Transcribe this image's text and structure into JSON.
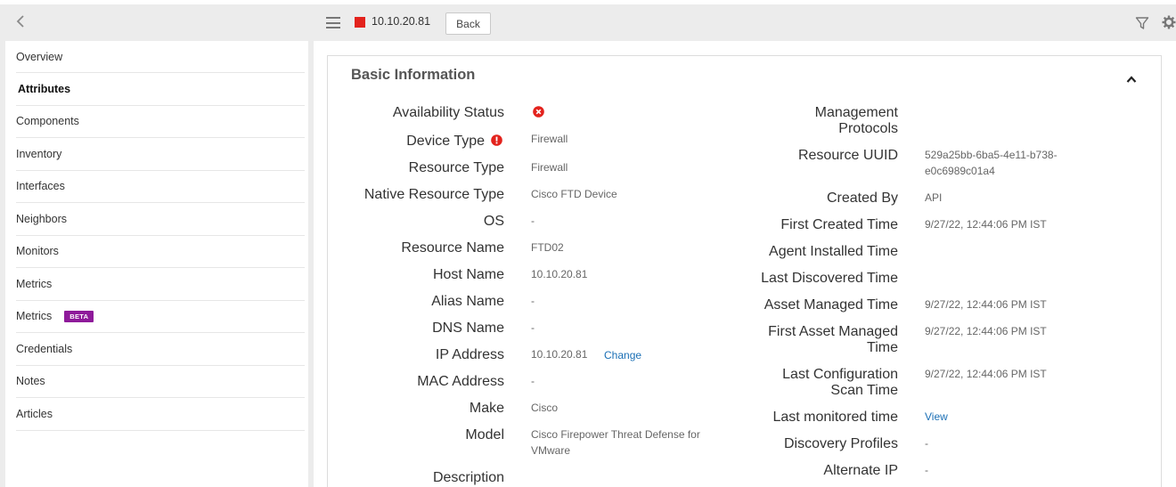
{
  "sidebar": {
    "items": [
      {
        "label": "Overview"
      },
      {
        "label": "Attributes"
      },
      {
        "label": "Components"
      },
      {
        "label": "Inventory"
      },
      {
        "label": "Interfaces"
      },
      {
        "label": "Neighbors"
      },
      {
        "label": "Monitors"
      },
      {
        "label": "Metrics"
      },
      {
        "label": "Metrics",
        "badge": "BETA"
      },
      {
        "label": "Credentials"
      },
      {
        "label": "Notes"
      },
      {
        "label": "Articles"
      }
    ]
  },
  "toolbar": {
    "title": "10.10.20.81",
    "back_label": "Back",
    "status_color": "#e3231d"
  },
  "panel": {
    "title": "Basic Information",
    "left": [
      {
        "label": "Availability Status",
        "value": ""
      },
      {
        "label": "Device Type",
        "value": "Firewall"
      },
      {
        "label": "Resource Type",
        "value": "Firewall"
      },
      {
        "label": "Native Resource Type",
        "value": "Cisco FTD Device"
      },
      {
        "label": "OS",
        "value": "-"
      },
      {
        "label": "Resource Name",
        "value": "FTD02"
      },
      {
        "label": "Host Name",
        "value": "10.10.20.81"
      },
      {
        "label": "Alias Name",
        "value": "-"
      },
      {
        "label": "DNS Name",
        "value": "-"
      },
      {
        "label": "IP Address",
        "value": "10.10.20.81",
        "link": "Change"
      },
      {
        "label": "MAC Address",
        "value": "-"
      },
      {
        "label": "Make",
        "value": "Cisco"
      },
      {
        "label": "Model",
        "value_line1": "Cisco Firepower Threat Defense for",
        "value_line2": "VMware"
      },
      {
        "label": "Description",
        "value": ""
      }
    ],
    "right": [
      {
        "label_line1": "Management",
        "label_line2": "Protocols",
        "value": ""
      },
      {
        "label": "Resource UUID",
        "value_line1": "529a25bb-6ba5-4e11-b738-",
        "value_line2": "e0c6989c01a4"
      },
      {
        "label": "Created By",
        "value": "API"
      },
      {
        "label": "First Created Time",
        "value": "9/27/22, 12:44:06 PM IST"
      },
      {
        "label": "Agent Installed Time",
        "value": ""
      },
      {
        "label": "Last Discovered Time",
        "value": ""
      },
      {
        "label": "Asset Managed Time",
        "value": "9/27/22, 12:44:06 PM IST"
      },
      {
        "label_line1": "First Asset Managed",
        "label_line2": "Time",
        "value": "9/27/22, 12:44:06 PM IST"
      },
      {
        "label_line1": "Last Configuration",
        "label_line2": "Scan Time",
        "value": "9/27/22, 12:44:06 PM IST"
      },
      {
        "label": "Last monitored time",
        "link": "View"
      },
      {
        "label": "Discovery Profiles",
        "value": "-"
      },
      {
        "label": "Alternate IP",
        "value": "-"
      }
    ]
  }
}
